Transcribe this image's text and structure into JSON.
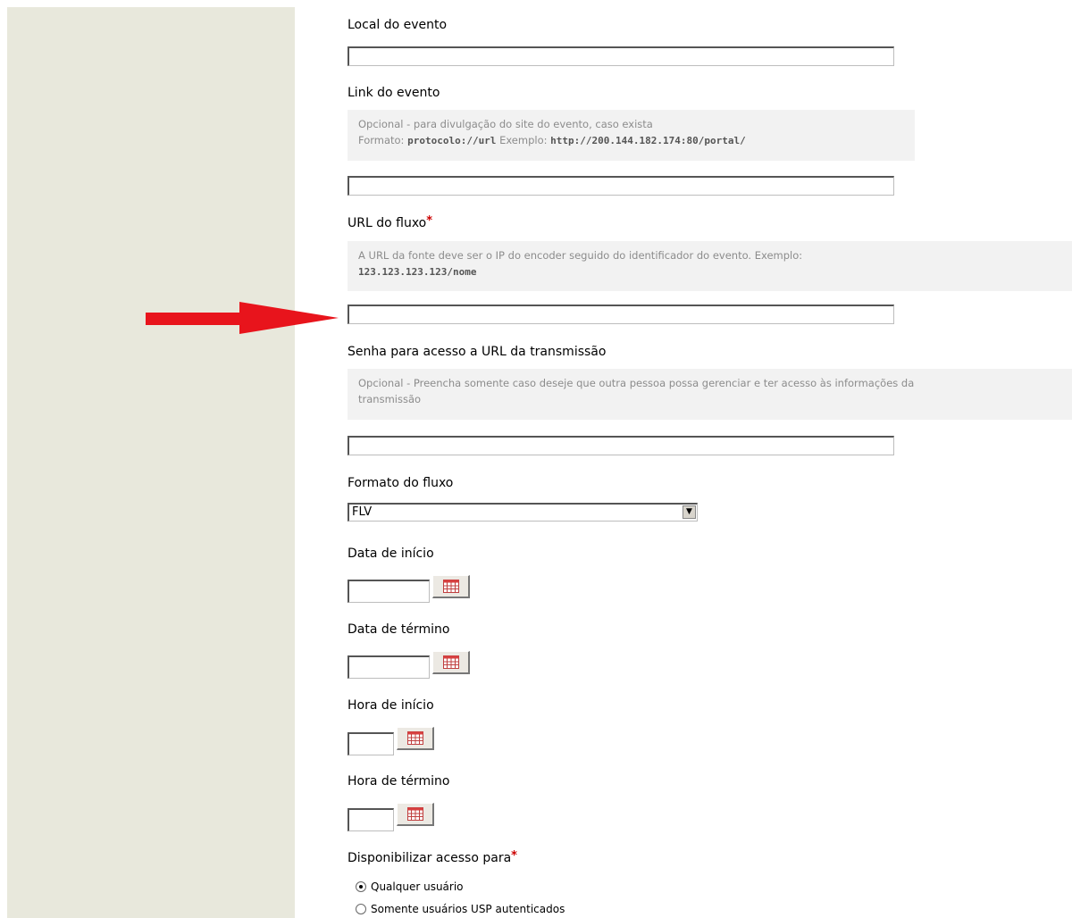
{
  "form": {
    "local_label": "Local do evento",
    "local_value": "",
    "link_label": "Link do evento",
    "link_help_line1": "Opcional - para divulgação do site do evento, caso exista",
    "link_help_format_prefix": "Formato: ",
    "link_help_format_code": "protocolo://url",
    "link_help_example_prefix": " Exemplo: ",
    "link_help_example_code": "http://200.144.182.174:80/portal/",
    "link_value": "",
    "url_label": "URL do fluxo",
    "url_required_mark": "*",
    "url_help_line1": "A URL da fonte deve ser o IP do encoder seguido do identificador do evento. Exemplo:",
    "url_help_code": "123.123.123.123/nome",
    "url_value": "",
    "senha_label": "Senha para acesso a URL da transmissão",
    "senha_help_line1": "Opcional - Preencha somente caso deseje que outra pessoa possa gerenciar e ter acesso às informações da",
    "senha_help_line2": "transmissão",
    "senha_value": "",
    "formato_label": "Formato do fluxo",
    "formato_selected": "FLV",
    "data_inicio_label": "Data de início",
    "data_termino_label": "Data de término",
    "hora_inicio_label": "Hora de início",
    "hora_termino_label": "Hora de término",
    "acesso_label": "Disponibilizar acesso para",
    "acesso_required_mark": "*",
    "acesso_options": [
      {
        "label": "Qualquer usuário",
        "checked": true
      },
      {
        "label": "Somente usuários USP autenticados",
        "checked": false
      }
    ]
  },
  "icons": {
    "calendar": "calendar-icon",
    "dropdown": "chevron-down-icon",
    "annotation": "red-arrow"
  },
  "colors": {
    "sidebar": "#e8e8dc",
    "required": "#cc0000",
    "help_bg": "#f2f2f2",
    "help_text": "#8c8c8c",
    "annotation_arrow": "#e8141c"
  }
}
